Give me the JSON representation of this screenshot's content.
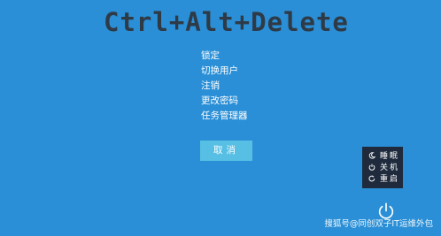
{
  "title_overlay": "Ctrl+Alt+Delete",
  "menu": {
    "items": [
      {
        "label": "锁定"
      },
      {
        "label": "切换用户"
      },
      {
        "label": "注销"
      },
      {
        "label": "更改密码"
      },
      {
        "label": "任务管理器"
      }
    ]
  },
  "cancel_button": {
    "label": "取消"
  },
  "power_menu": {
    "options": [
      {
        "label": "睡眠",
        "icon": "sleep-icon"
      },
      {
        "label": "关机",
        "icon": "shutdown-icon"
      },
      {
        "label": "重启",
        "icon": "restart-icon"
      }
    ]
  },
  "power_button": {
    "icon": "power-icon"
  },
  "watermark": "搜狐号@同创双子IT运维外包",
  "colors": {
    "background": "#2a8fd6",
    "cancel_button": "#58bfe4",
    "power_menu": "#1f2b3d",
    "overlay_text": "#2f3a47"
  }
}
